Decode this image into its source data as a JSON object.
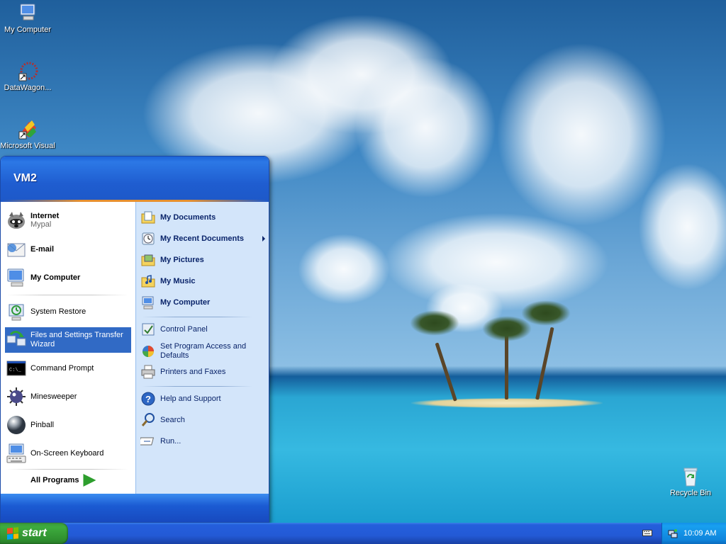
{
  "desktop": {
    "icons": [
      {
        "label": "My Computer"
      },
      {
        "label": "DataWagon..."
      },
      {
        "label": "Microsoft Visual"
      },
      {
        "label": "Recycle Bin"
      }
    ]
  },
  "start_menu": {
    "user": "VM2",
    "left": {
      "pinned": [
        {
          "label": "Internet",
          "sub": "Mypal"
        },
        {
          "label": "E-mail"
        },
        {
          "label": "My Computer"
        }
      ],
      "recent": [
        {
          "label": "System Restore"
        },
        {
          "label": "Files and Settings Transfer Wizard"
        },
        {
          "label": "Command Prompt"
        },
        {
          "label": "Minesweeper"
        },
        {
          "label": "Pinball"
        },
        {
          "label": "On-Screen Keyboard"
        }
      ],
      "all_programs": "All Programs"
    },
    "right": {
      "places": [
        {
          "label": "My Documents"
        },
        {
          "label": "My Recent Documents"
        },
        {
          "label": "My Pictures"
        },
        {
          "label": "My Music"
        },
        {
          "label": "My Computer"
        }
      ],
      "settings": [
        {
          "label": "Control Panel"
        },
        {
          "label": "Set Program Access and Defaults"
        },
        {
          "label": "Printers and Faxes"
        }
      ],
      "tools": [
        {
          "label": "Help and Support"
        },
        {
          "label": "Search"
        },
        {
          "label": "Run..."
        }
      ]
    }
  },
  "taskbar": {
    "start_label": "start",
    "clock": "10:09 AM"
  },
  "colors": {
    "taskbar": "#245edc",
    "start_button": "#3eac3e",
    "selection": "#316ac5",
    "tray": "#0f85dc"
  }
}
